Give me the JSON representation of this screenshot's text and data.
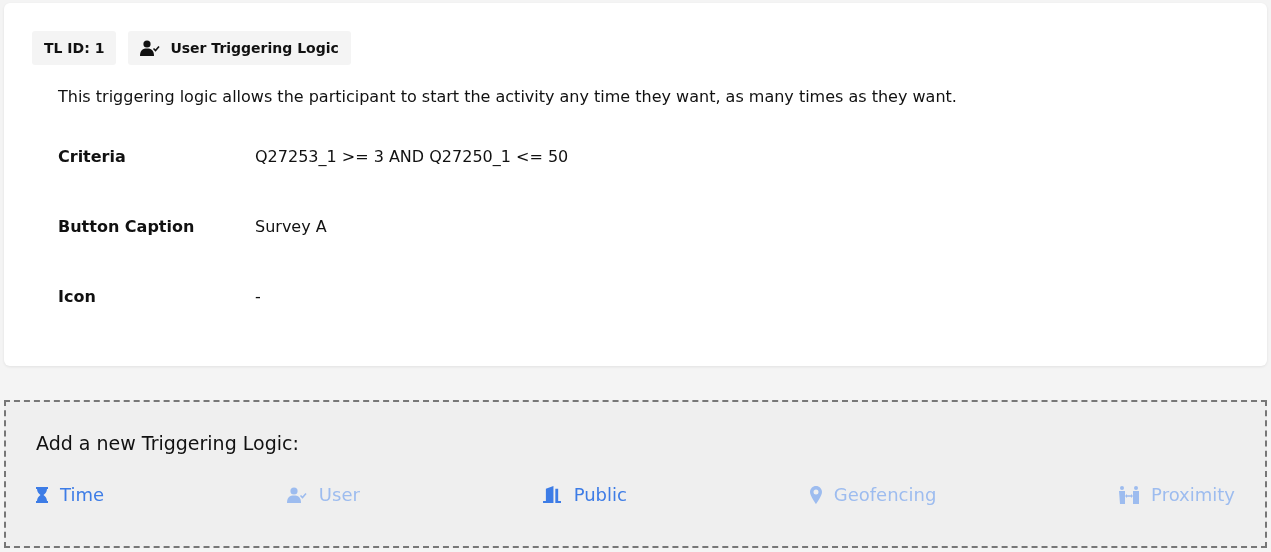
{
  "card": {
    "id_badge": "TL ID: 1",
    "type_badge": "User Triggering Logic",
    "description": "This triggering logic allows the participant to start the activity any time they want, as many times as they want.",
    "fields": [
      {
        "label": "Criteria",
        "value": "Q27253_1 >= 3 AND Q27250_1 <= 50"
      },
      {
        "label": "Button Caption",
        "value": "Survey A"
      },
      {
        "label": "Icon",
        "value": "-"
      }
    ]
  },
  "add_panel": {
    "title": "Add a new Triggering Logic:",
    "options": [
      {
        "kind": "time",
        "label": "Time",
        "disabled": false
      },
      {
        "kind": "user",
        "label": "User",
        "disabled": true
      },
      {
        "kind": "public",
        "label": "Public",
        "disabled": false
      },
      {
        "kind": "geofencing",
        "label": "Geofencing",
        "disabled": true
      },
      {
        "kind": "proximity",
        "label": "Proximity",
        "disabled": true
      }
    ]
  }
}
